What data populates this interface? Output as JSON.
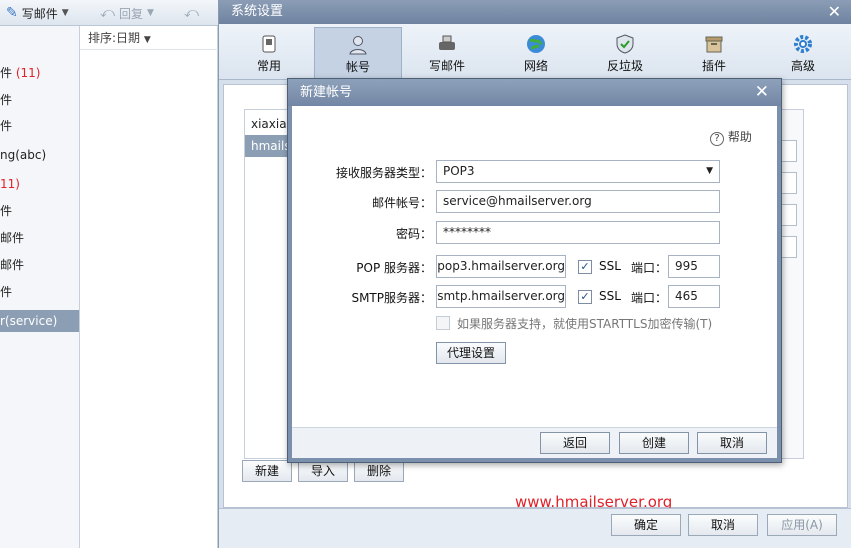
{
  "toolbar": {
    "compose": "写邮件",
    "reply": "回复"
  },
  "list": {
    "sort_label": "排序:日期"
  },
  "folders": [
    {
      "text": "(11)",
      "red": true,
      "prefix": "件"
    },
    {
      "text": "件"
    },
    {
      "text": "件"
    },
    {
      "text": "ng(abc)"
    },
    {
      "text": "11)",
      "red": true
    },
    {
      "text": "件"
    },
    {
      "text": "邮件"
    },
    {
      "text": "邮件"
    },
    {
      "text": "件"
    },
    {
      "text": "r(service)",
      "selected": true
    }
  ],
  "settings": {
    "title": "系统设置",
    "tabs": [
      {
        "label": "常用",
        "icon": "phone-icon"
      },
      {
        "label": "帐号",
        "icon": "user-icon",
        "selected": true
      },
      {
        "label": "写邮件",
        "icon": "printer-icon"
      },
      {
        "label": "网络",
        "icon": "globe-icon"
      },
      {
        "label": "反垃圾",
        "icon": "shield-icon"
      },
      {
        "label": "插件",
        "icon": "box-icon"
      },
      {
        "label": "高级",
        "icon": "gear-icon"
      }
    ],
    "accounts": [
      "xiaxian",
      "hmails"
    ],
    "buttons": {
      "new": "新建",
      "import": "导入",
      "delete": "删除",
      "ok": "确定",
      "cancel": "取消",
      "apply": "应用(A)"
    },
    "watermark": "www.hmailserver.org"
  },
  "dialog": {
    "title": "新建帐号",
    "help": "帮助",
    "server_type_label": "接收服务器类型：",
    "server_type": "POP3",
    "email_label": "邮件帐号：",
    "email": "service@hmailserver.org",
    "password_label": "密码：",
    "password": "********",
    "pop_label": "POP 服务器：",
    "pop_server": "pop3.hmailserver.org",
    "pop_ssl": "SSL",
    "port_label": "端口：",
    "pop_port": "995",
    "smtp_label": "SMTP服务器：",
    "smtp_server": "smtp.hmailserver.org",
    "smtp_ssl": "SSL",
    "smtp_port": "465",
    "starttls": "如果服务器支持，就使用STARTTLS加密传输(T)",
    "proxy": "代理设置",
    "back": "返回",
    "create": "创建",
    "cancel": "取消"
  },
  "colors": {
    "accent": "#8c9eb4",
    "watermark": "#e0222a",
    "titlebar": "#7b90ad"
  }
}
